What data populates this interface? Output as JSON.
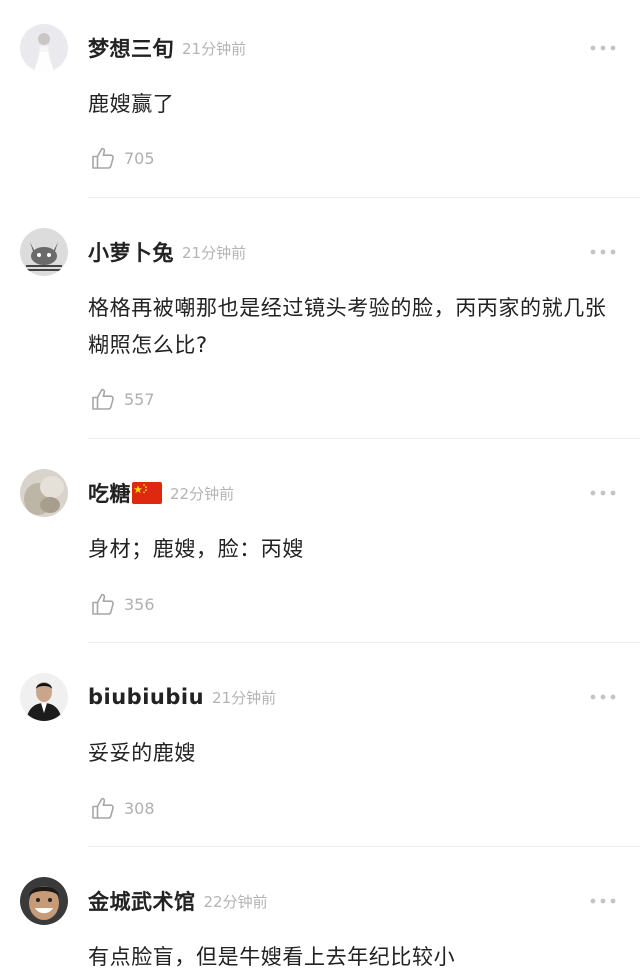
{
  "comments": [
    {
      "username": "梦想三旬",
      "time": "21分钟前",
      "avatar": "avatar-woman-in-white-dress",
      "text": "鹿嫂赢了",
      "likes": "705"
    },
    {
      "username": "小萝卜兔",
      "time": "21分钟前",
      "avatar": "avatar-cat",
      "text": "格格再被嘲那也是经过镜头考验的脸，丙丙家的就几张糊照怎么比?",
      "likes": "557"
    },
    {
      "username": "吃糖",
      "flag": "china-flag-icon",
      "time": "22分钟前",
      "avatar": "avatar-blurry-photo",
      "text": "身材；鹿嫂，脸：丙嫂",
      "likes": "356"
    },
    {
      "username": "biubiubiu",
      "time": "21分钟前",
      "avatar": "avatar-man-in-suit",
      "text": "妥妥的鹿嫂",
      "likes": "308"
    },
    {
      "username": "金城武术馆",
      "time": "22分钟前",
      "avatar": "avatar-laughing-man",
      "text": "有点脸盲，但是牛嫂看上去年纪比较小",
      "likes": ""
    }
  ],
  "icons": {
    "like": "thumbs-up-icon",
    "more": "more-dots-icon"
  },
  "colors": {
    "text": "#222222",
    "meta": "#b4b4b4",
    "divider": "#ececec"
  }
}
